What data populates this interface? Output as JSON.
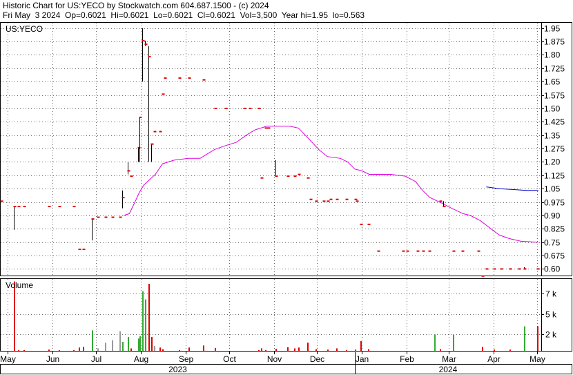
{
  "header": {
    "line1": "Historic Chart for US:YECO by Stockwatch.com 604.687.1500 - (c) 2024",
    "line2": "Fri May  3 2024  Op=0.6021  Hi=0.6021  Lo=0.6021  Cl=0.6021  Vol=3,500  Year hi=1.95  lo=0.563"
  },
  "colors": {
    "price_bar": "#000000",
    "price_tick": "#dd0000",
    "ma_long": "#dd00dd",
    "ma_short": "#0000cc",
    "vol_up": "#33aa33",
    "vol_down": "#dd0000",
    "vol_flat": "#999999",
    "grid": "#000000"
  },
  "chart_data": [
    {
      "type": "line",
      "title": "US:YECO",
      "grid": true,
      "ylim": [
        0.563,
        1.98
      ],
      "yticks": [
        "1.95",
        "1.875",
        "1.80",
        "1.725",
        "1.65",
        "1.575",
        "1.50",
        "1.425",
        "1.35",
        "1.275",
        "1.20",
        "1.125",
        "1.05",
        "0.975",
        "0.90",
        "0.825",
        "0.75",
        "0.675",
        "0.60"
      ],
      "ytick_values": [
        1.95,
        1.875,
        1.8,
        1.725,
        1.65,
        1.575,
        1.5,
        1.425,
        1.35,
        1.275,
        1.2,
        1.125,
        1.05,
        0.975,
        0.9,
        0.825,
        0.75,
        0.675,
        0.6
      ],
      "x_months": [
        {
          "label": "May",
          "day": 5
        },
        {
          "label": "Jun",
          "day": 36
        },
        {
          "label": "Jul",
          "day": 66
        },
        {
          "label": "Aug",
          "day": 97
        },
        {
          "label": "Sep",
          "day": 128
        },
        {
          "label": "Oct",
          "day": 158
        },
        {
          "label": "Nov",
          "day": 189
        },
        {
          "label": "Dec",
          "day": 219
        },
        {
          "label": "Jan",
          "day": 250
        },
        {
          "label": "Feb",
          "day": 281
        },
        {
          "label": "Mar",
          "day": 310
        },
        {
          "label": "Apr",
          "day": 341
        },
        {
          "label": "May",
          "day": 371
        }
      ],
      "x_years": [
        {
          "label": "2023",
          "from_day": 0,
          "to_day": 245
        },
        {
          "label": "2024",
          "from_day": 245,
          "to_day": 374
        }
      ],
      "series": [
        {
          "role": "price",
          "points": [
            {
              "d": 0,
              "h": 0.98,
              "l": 0.98,
              "c": 0.98
            },
            {
              "d": 9,
              "h": 0.95,
              "l": 0.82,
              "c": 0.95
            },
            {
              "d": 12,
              "h": 0.95,
              "l": 0.95,
              "c": 0.95
            },
            {
              "d": 16,
              "h": 0.95,
              "l": 0.95,
              "c": 0.95
            },
            {
              "d": 33,
              "h": 0.95,
              "l": 0.95,
              "c": 0.95
            },
            {
              "d": 40,
              "h": 0.95,
              "l": 0.95,
              "c": 0.95
            },
            {
              "d": 50,
              "h": 0.95,
              "l": 0.95,
              "c": 0.95
            },
            {
              "d": 54,
              "h": 0.71,
              "l": 0.71,
              "c": 0.71
            },
            {
              "d": 57,
              "h": 0.71,
              "l": 0.71,
              "c": 0.71
            },
            {
              "d": 63,
              "h": 0.88,
              "l": 0.76,
              "c": 0.88
            },
            {
              "d": 67,
              "h": 0.89,
              "l": 0.89,
              "c": 0.89
            },
            {
              "d": 72,
              "h": 0.89,
              "l": 0.89,
              "c": 0.89
            },
            {
              "d": 77,
              "h": 0.89,
              "l": 0.89,
              "c": 0.89
            },
            {
              "d": 82,
              "h": 0.89,
              "l": 0.89,
              "c": 0.89
            },
            {
              "d": 84,
              "h": 1.04,
              "l": 0.94,
              "c": 1.0
            },
            {
              "d": 88,
              "h": 1.2,
              "l": 1.13,
              "c": 1.15
            },
            {
              "d": 90,
              "h": 1.12,
              "l": 1.12,
              "c": 1.12
            },
            {
              "d": 95,
              "h": 1.28,
              "l": 1.2,
              "c": 1.28
            },
            {
              "d": 96,
              "h": 1.45,
              "l": 1.2,
              "c": 1.45
            },
            {
              "d": 98,
              "h": 1.95,
              "l": 1.65,
              "c": 1.88
            },
            {
              "d": 100,
              "h": 1.88,
              "l": 1.85,
              "c": 1.86
            },
            {
              "d": 102,
              "h": 1.85,
              "l": 1.2,
              "c": 1.79
            },
            {
              "d": 104,
              "h": 1.3,
              "l": 1.2,
              "c": 1.3
            },
            {
              "d": 106,
              "h": 1.37,
              "l": 1.37,
              "c": 1.37
            },
            {
              "d": 110,
              "h": 1.37,
              "l": 1.37,
              "c": 1.37
            },
            {
              "d": 112,
              "h": 1.58,
              "l": 1.58,
              "c": 1.58
            },
            {
              "d": 113,
              "h": 1.67,
              "l": 1.67,
              "c": 1.67
            },
            {
              "d": 123,
              "h": 1.67,
              "l": 1.67,
              "c": 1.67
            },
            {
              "d": 130,
              "h": 1.67,
              "l": 1.67,
              "c": 1.67
            },
            {
              "d": 140,
              "h": 1.66,
              "l": 1.66,
              "c": 1.66
            },
            {
              "d": 148,
              "h": 1.5,
              "l": 1.5,
              "c": 1.5
            },
            {
              "d": 155,
              "h": 1.5,
              "l": 1.5,
              "c": 1.5
            },
            {
              "d": 168,
              "h": 1.5,
              "l": 1.5,
              "c": 1.5
            },
            {
              "d": 172,
              "h": 1.5,
              "l": 1.5,
              "c": 1.5
            },
            {
              "d": 178,
              "h": 1.5,
              "l": 1.5,
              "c": 1.5
            },
            {
              "d": 180,
              "h": 1.11,
              "l": 1.11,
              "c": 1.11
            },
            {
              "d": 183,
              "h": 1.39,
              "l": 1.39,
              "c": 1.39
            },
            {
              "d": 185,
              "h": 1.39,
              "l": 1.39,
              "c": 1.39
            },
            {
              "d": 190,
              "h": 1.21,
              "l": 1.12,
              "c": 1.12
            },
            {
              "d": 198,
              "h": 1.12,
              "l": 1.12,
              "c": 1.12
            },
            {
              "d": 203,
              "h": 1.12,
              "l": 1.12,
              "c": 1.12
            },
            {
              "d": 206,
              "h": 1.13,
              "l": 1.13,
              "c": 1.13
            },
            {
              "d": 212,
              "h": 1.11,
              "l": 1.11,
              "c": 1.11
            },
            {
              "d": 214,
              "h": 0.99,
              "l": 0.99,
              "c": 0.99
            },
            {
              "d": 218,
              "h": 0.98,
              "l": 0.98,
              "c": 0.98
            },
            {
              "d": 223,
              "h": 0.98,
              "l": 0.98,
              "c": 0.98
            },
            {
              "d": 226,
              "h": 0.98,
              "l": 0.98,
              "c": 0.98
            },
            {
              "d": 228,
              "h": 0.99,
              "l": 0.99,
              "c": 0.99
            },
            {
              "d": 232,
              "h": 0.99,
              "l": 0.99,
              "c": 0.99
            },
            {
              "d": 239,
              "h": 0.99,
              "l": 0.99,
              "c": 0.99
            },
            {
              "d": 245,
              "h": 0.99,
              "l": 0.99,
              "c": 0.99
            },
            {
              "d": 246,
              "h": 0.98,
              "l": 0.98,
              "c": 0.98
            },
            {
              "d": 249,
              "h": 0.85,
              "l": 0.85,
              "c": 0.85
            },
            {
              "d": 254,
              "h": 0.85,
              "l": 0.85,
              "c": 0.85
            },
            {
              "d": 261,
              "h": 0.7,
              "l": 0.7,
              "c": 0.7
            },
            {
              "d": 278,
              "h": 0.7,
              "l": 0.7,
              "c": 0.7
            },
            {
              "d": 281,
              "h": 0.7,
              "l": 0.7,
              "c": 0.7
            },
            {
              "d": 288,
              "h": 0.7,
              "l": 0.7,
              "c": 0.7
            },
            {
              "d": 292,
              "h": 0.7,
              "l": 0.7,
              "c": 0.7
            },
            {
              "d": 296,
              "h": 0.7,
              "l": 0.7,
              "c": 0.7
            },
            {
              "d": 304,
              "h": 0.98,
              "l": 0.98,
              "c": 0.98
            },
            {
              "d": 306,
              "h": 0.98,
              "l": 0.95,
              "c": 0.95
            },
            {
              "d": 313,
              "h": 0.7,
              "l": 0.7,
              "c": 0.7
            },
            {
              "d": 319,
              "h": 0.7,
              "l": 0.7,
              "c": 0.7
            },
            {
              "d": 330,
              "h": 0.7,
              "l": 0.7,
              "c": 0.7
            },
            {
              "d": 333,
              "h": 0.56,
              "l": 0.56,
              "c": 0.56
            },
            {
              "d": 336,
              "h": 0.6,
              "l": 0.6,
              "c": 0.6
            },
            {
              "d": 341,
              "h": 0.6,
              "l": 0.6,
              "c": 0.6
            },
            {
              "d": 346,
              "h": 0.6,
              "l": 0.6,
              "c": 0.6
            },
            {
              "d": 352,
              "h": 0.6,
              "l": 0.6,
              "c": 0.6
            },
            {
              "d": 358,
              "h": 0.6,
              "l": 0.6,
              "c": 0.6
            },
            {
              "d": 362,
              "h": 0.61,
              "l": 0.6,
              "c": 0.6
            },
            {
              "d": 371,
              "h": 0.6,
              "l": 0.6,
              "c": 0.6
            }
          ]
        },
        {
          "role": "moving-average-long",
          "points": [
            [
              85,
              0.9
            ],
            [
              89,
              0.91
            ],
            [
              92,
              0.96
            ],
            [
              96,
              1.03
            ],
            [
              99,
              1.07
            ],
            [
              103,
              1.1
            ],
            [
              107,
              1.13
            ],
            [
              112,
              1.19
            ],
            [
              120,
              1.21
            ],
            [
              130,
              1.22
            ],
            [
              138,
              1.22
            ],
            [
              142,
              1.24
            ],
            [
              148,
              1.27
            ],
            [
              155,
              1.29
            ],
            [
              163,
              1.31
            ],
            [
              170,
              1.35
            ],
            [
              176,
              1.38
            ],
            [
              184,
              1.4
            ],
            [
              192,
              1.4
            ],
            [
              200,
              1.4
            ],
            [
              206,
              1.39
            ],
            [
              212,
              1.34
            ],
            [
              220,
              1.27
            ],
            [
              226,
              1.23
            ],
            [
              235,
              1.22
            ],
            [
              240,
              1.2
            ],
            [
              245,
              1.16
            ],
            [
              250,
              1.15
            ],
            [
              255,
              1.13
            ],
            [
              270,
              1.13
            ],
            [
              280,
              1.12
            ],
            [
              287,
              1.09
            ],
            [
              292,
              1.04
            ],
            [
              297,
              1.0
            ],
            [
              305,
              0.97
            ],
            [
              312,
              0.94
            ],
            [
              320,
              0.91
            ],
            [
              325,
              0.9
            ],
            [
              332,
              0.87
            ],
            [
              340,
              0.82
            ],
            [
              345,
              0.79
            ],
            [
              352,
              0.77
            ],
            [
              360,
              0.755
            ],
            [
              372,
              0.75
            ]
          ]
        },
        {
          "role": "moving-average-short",
          "points": [
            [
              336,
              1.06
            ],
            [
              345,
              1.05
            ],
            [
              355,
              1.045
            ],
            [
              364,
              1.04
            ],
            [
              372,
              1.04
            ]
          ]
        }
      ]
    },
    {
      "type": "bar",
      "title": "Volume",
      "ylim": [
        0,
        8800
      ],
      "yticks": [
        "7 k",
        "5 k",
        "2 k"
      ],
      "ytick_values": [
        7000,
        4500,
        2000
      ],
      "bars": [
        {
          "d": 9,
          "v": 8500,
          "dir": "down"
        },
        {
          "d": 12,
          "v": 100,
          "dir": "down"
        },
        {
          "d": 16,
          "v": 100,
          "dir": "down"
        },
        {
          "d": 33,
          "v": 150,
          "dir": "down"
        },
        {
          "d": 40,
          "v": 80,
          "dir": "down"
        },
        {
          "d": 50,
          "v": 80,
          "dir": "down"
        },
        {
          "d": 54,
          "v": 400,
          "dir": "down"
        },
        {
          "d": 57,
          "v": 500,
          "dir": "down"
        },
        {
          "d": 63,
          "v": 2500,
          "dir": "up"
        },
        {
          "d": 67,
          "v": 300,
          "dir": "flat"
        },
        {
          "d": 72,
          "v": 1000,
          "dir": "flat"
        },
        {
          "d": 77,
          "v": 1300,
          "dir": "flat"
        },
        {
          "d": 82,
          "v": 2400,
          "dir": "flat"
        },
        {
          "d": 84,
          "v": 1100,
          "dir": "up"
        },
        {
          "d": 88,
          "v": 1700,
          "dir": "up"
        },
        {
          "d": 90,
          "v": 300,
          "dir": "down"
        },
        {
          "d": 95,
          "v": 1500,
          "dir": "up"
        },
        {
          "d": 96,
          "v": 1800,
          "dir": "up"
        },
        {
          "d": 98,
          "v": 7300,
          "dir": "up"
        },
        {
          "d": 100,
          "v": 6300,
          "dir": "up"
        },
        {
          "d": 102,
          "v": 8200,
          "dir": "down"
        },
        {
          "d": 104,
          "v": 1700,
          "dir": "down"
        },
        {
          "d": 106,
          "v": 600,
          "dir": "flat"
        },
        {
          "d": 110,
          "v": 400,
          "dir": "down"
        },
        {
          "d": 112,
          "v": 200,
          "dir": "down"
        },
        {
          "d": 123,
          "v": 100,
          "dir": "down"
        },
        {
          "d": 130,
          "v": 400,
          "dir": "down"
        },
        {
          "d": 140,
          "v": 650,
          "dir": "down"
        },
        {
          "d": 148,
          "v": 350,
          "dir": "down"
        },
        {
          "d": 178,
          "v": 100,
          "dir": "down"
        },
        {
          "d": 180,
          "v": 300,
          "dir": "down"
        },
        {
          "d": 183,
          "v": 100,
          "dir": "down"
        },
        {
          "d": 190,
          "v": 250,
          "dir": "down"
        },
        {
          "d": 198,
          "v": 450,
          "dir": "down"
        },
        {
          "d": 203,
          "v": 300,
          "dir": "down"
        },
        {
          "d": 206,
          "v": 400,
          "dir": "down"
        },
        {
          "d": 212,
          "v": 1000,
          "dir": "down"
        },
        {
          "d": 218,
          "v": 200,
          "dir": "down"
        },
        {
          "d": 226,
          "v": 150,
          "dir": "down"
        },
        {
          "d": 232,
          "v": 300,
          "dir": "down"
        },
        {
          "d": 239,
          "v": 100,
          "dir": "down"
        },
        {
          "d": 245,
          "v": 150,
          "dir": "down"
        },
        {
          "d": 249,
          "v": 1200,
          "dir": "down"
        },
        {
          "d": 254,
          "v": 200,
          "dir": "down"
        },
        {
          "d": 300,
          "v": 2000,
          "dir": "up"
        },
        {
          "d": 304,
          "v": 200,
          "dir": "down"
        },
        {
          "d": 313,
          "v": 2000,
          "dir": "up"
        },
        {
          "d": 333,
          "v": 500,
          "dir": "down"
        },
        {
          "d": 341,
          "v": 150,
          "dir": "down"
        },
        {
          "d": 352,
          "v": 150,
          "dir": "down"
        },
        {
          "d": 362,
          "v": 3000,
          "dir": "up"
        },
        {
          "d": 371,
          "v": 3000,
          "dir": "down"
        }
      ]
    }
  ]
}
